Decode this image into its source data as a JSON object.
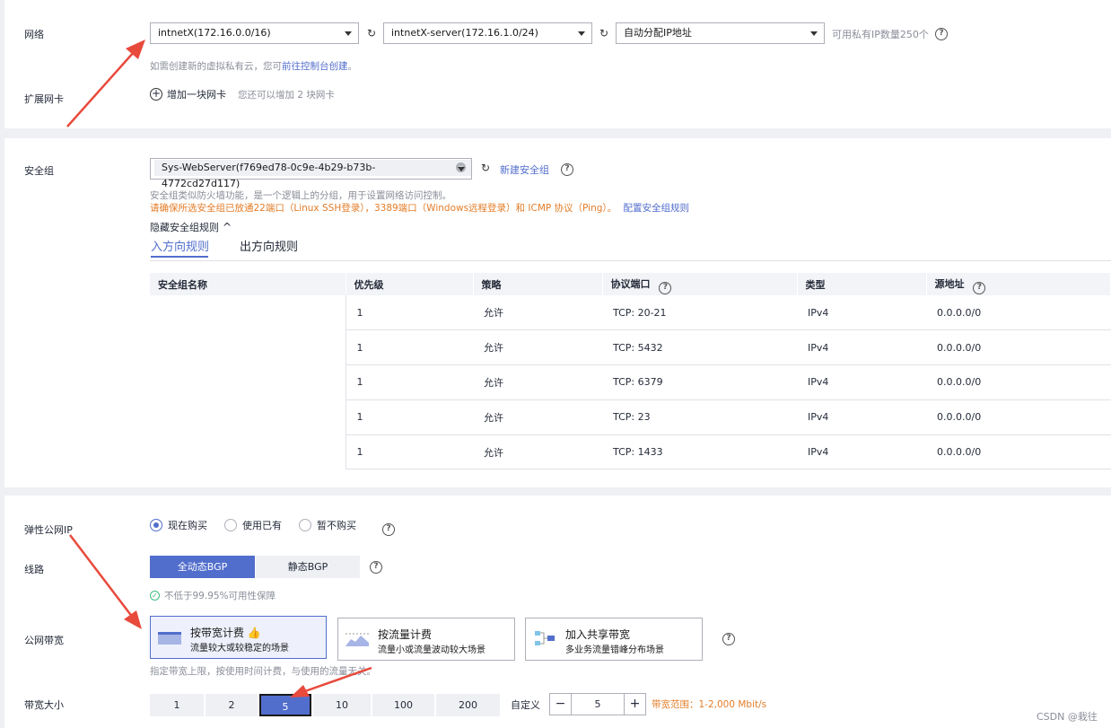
{
  "network": {
    "label": "网络",
    "vpc_select": "intnetX(172.16.0.0/16)",
    "subnet_select": "intnetX-server(172.16.1.0/24)",
    "ip_select": "自动分配IP地址",
    "available_ips": "可用私有IP数量250个",
    "hint_prefix": "如需创建新的虚拟私有云，您可",
    "hint_link": "前往控制台创建",
    "hint_suffix": "。",
    "nic_label": "扩展网卡",
    "add_nic": "增加一块网卡",
    "nic_hint": "您还可以增加 2 块网卡"
  },
  "security": {
    "label": "安全组",
    "selected": "Sys-WebServer(f769ed78-0c9e-4b29-b73b-4772cd27d117)",
    "create_link": "新建安全组",
    "desc": "安全组类似防火墙功能，是一个逻辑上的分组，用于设置网络访问控制。",
    "warning": "请确保所选安全组已放通22端口（Linux SSH登录），3389端口（Windows远程登录）和 ICMP 协议（Ping）。",
    "config_link": "配置安全组规则",
    "hide_rules": "隐藏安全组规则",
    "tab_in": "入方向规则",
    "tab_out": "出方向规则",
    "columns": [
      "安全组名称",
      "优先级",
      "策略",
      "协议端口",
      "类型",
      "源地址"
    ],
    "rows": [
      {
        "priority": "1",
        "policy": "允许",
        "port": "TCP: 20-21",
        "type": "IPv4",
        "source": "0.0.0.0/0"
      },
      {
        "priority": "1",
        "policy": "允许",
        "port": "TCP: 5432",
        "type": "IPv4",
        "source": "0.0.0.0/0"
      },
      {
        "priority": "1",
        "policy": "允许",
        "port": "TCP: 6379",
        "type": "IPv4",
        "source": "0.0.0.0/0"
      },
      {
        "priority": "1",
        "policy": "允许",
        "port": "TCP: 23",
        "type": "IPv4",
        "source": "0.0.0.0/0"
      },
      {
        "priority": "1",
        "policy": "允许",
        "port": "TCP: 1433",
        "type": "IPv4",
        "source": "0.0.0.0/0"
      }
    ]
  },
  "eip": {
    "label": "弹性公网IP",
    "opt_buy": "现在购买",
    "opt_existing": "使用已有",
    "opt_none": "暂不购买",
    "line_label": "线路",
    "line_bgp_full": "全动态BGP",
    "line_bgp_static": "静态BGP",
    "availability": "不低于99.95%可用性保障",
    "bw_label": "公网带宽",
    "card1_title": "按带宽计费",
    "card1_desc": "流量较大或较稳定的场景",
    "card2_title": "按流量计费",
    "card2_desc": "流量小或流量波动较大场景",
    "card3_title": "加入共享带宽",
    "card3_desc": "多业务流量错峰分布场景",
    "bw_hint": "指定带宽上限，按使用时间计费，与使用的流量无关。",
    "size_label": "带宽大小",
    "sizes": [
      "1",
      "2",
      "5",
      "10",
      "100",
      "200"
    ],
    "custom_label": "自定义",
    "custom_value": "5",
    "range": "带宽范围：1-2,000 Mbit/s"
  },
  "watermark": "CSDN @栽往",
  "colors": {
    "primary": "#526ecc",
    "warning": "#e37d29",
    "arrow": "#e84a3c"
  }
}
